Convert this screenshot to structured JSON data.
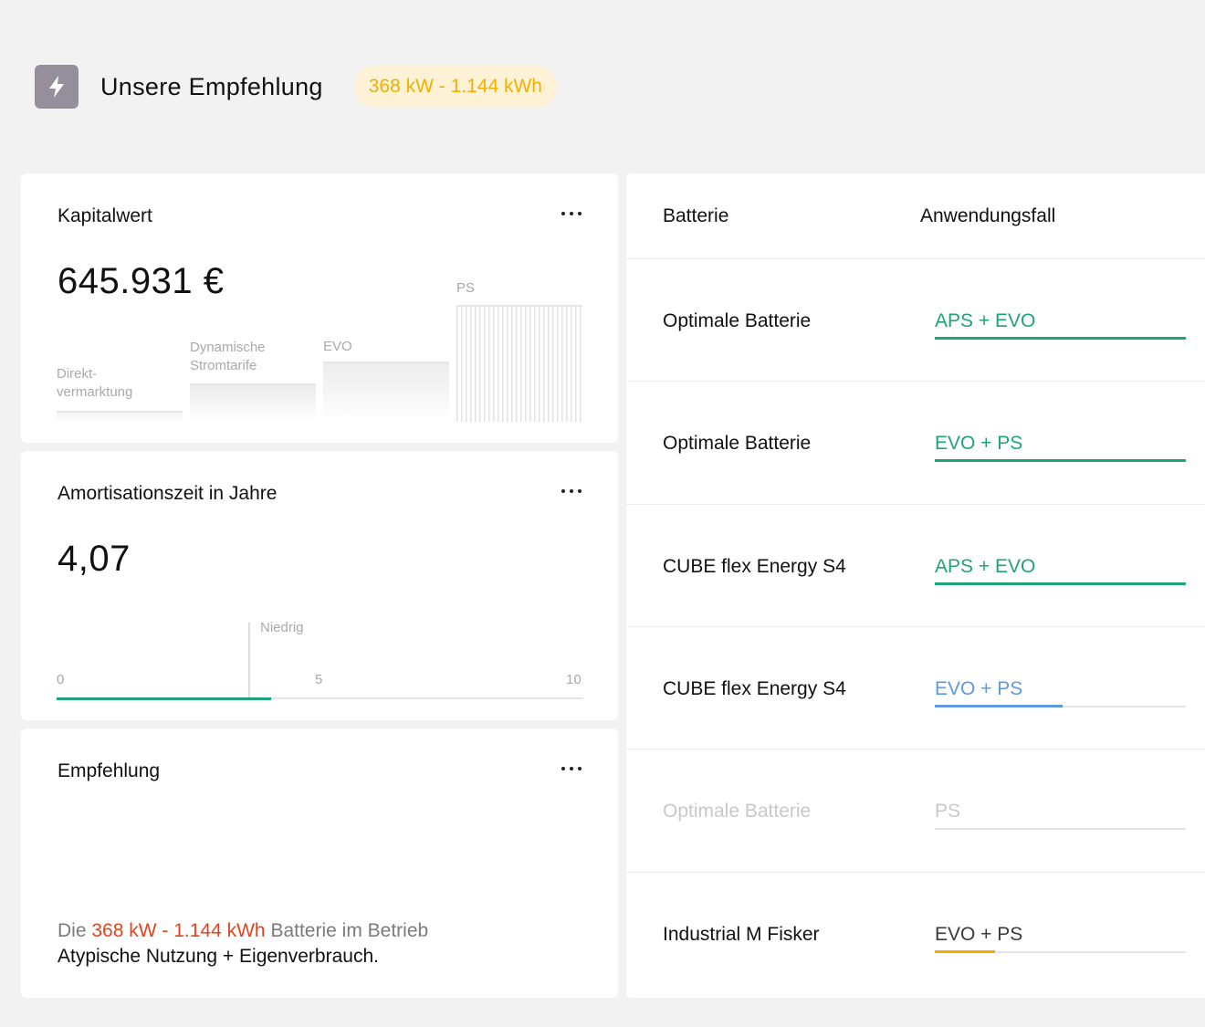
{
  "header": {
    "icon": "lightning-bolt-icon",
    "title": "Unsere Empfehlung",
    "badge": "368 kW - 1.144 kWh"
  },
  "colors": {
    "green": "#1fa378",
    "blue": "#5d9ae0",
    "yellow": "#f0b000",
    "orange_highlight": "#e0461e",
    "muted": "#c8c8c8"
  },
  "kapitalwert": {
    "title": "Kapitalwert",
    "value": "645.931 €",
    "bars": [
      {
        "label_line1": "Direkt-",
        "label_line2": "vermarktung"
      },
      {
        "label_line1": "Dynamische",
        "label_line2": "Stromtarife"
      },
      {
        "label_line1": "EVO",
        "label_line2": ""
      },
      {
        "label_line1": "PS",
        "label_line2": ""
      }
    ]
  },
  "amortisation": {
    "title": "Amortisationszeit in Jahre",
    "value": "4,07",
    "scale": {
      "min": "0",
      "mid": "5",
      "max": "10",
      "marker_label": "Niedrig"
    },
    "progress_fraction": 0.407
  },
  "empfehlung": {
    "title": "Empfehlung",
    "text_prefix": "Die ",
    "text_highlight": "368 kW - 1.144 kWh",
    "text_suffix": " Batterie im Betrieb",
    "text_line2": "Atypische Nutzung + Eigenverbrauch."
  },
  "table": {
    "col_battery": "Batterie",
    "col_usecase": "Anwendungsfall",
    "rows": [
      {
        "battery": "Optimale Batterie",
        "usecase": "APS + EVO",
        "fill": 1.0,
        "color": "#1fa378",
        "muted": false
      },
      {
        "battery": "Optimale Batterie",
        "usecase": "EVO + PS",
        "fill": 1.0,
        "color": "#1fa378",
        "muted": false
      },
      {
        "battery": "CUBE flex Energy S4",
        "usecase": "APS + EVO",
        "fill": 1.0,
        "color": "#1fa378",
        "muted": false
      },
      {
        "battery": "CUBE flex Energy S4",
        "usecase": "EVO + PS",
        "fill": 0.51,
        "color": "#5d9ae0",
        "muted": false
      },
      {
        "battery": "Optimale Batterie",
        "usecase": "PS",
        "fill": 0.0,
        "color": "#c8c8c8",
        "muted": true
      },
      {
        "battery": "Industrial M Fisker",
        "usecase": "EVO + PS",
        "fill": 0.24,
        "color": "#f0b000",
        "muted": false
      }
    ]
  }
}
